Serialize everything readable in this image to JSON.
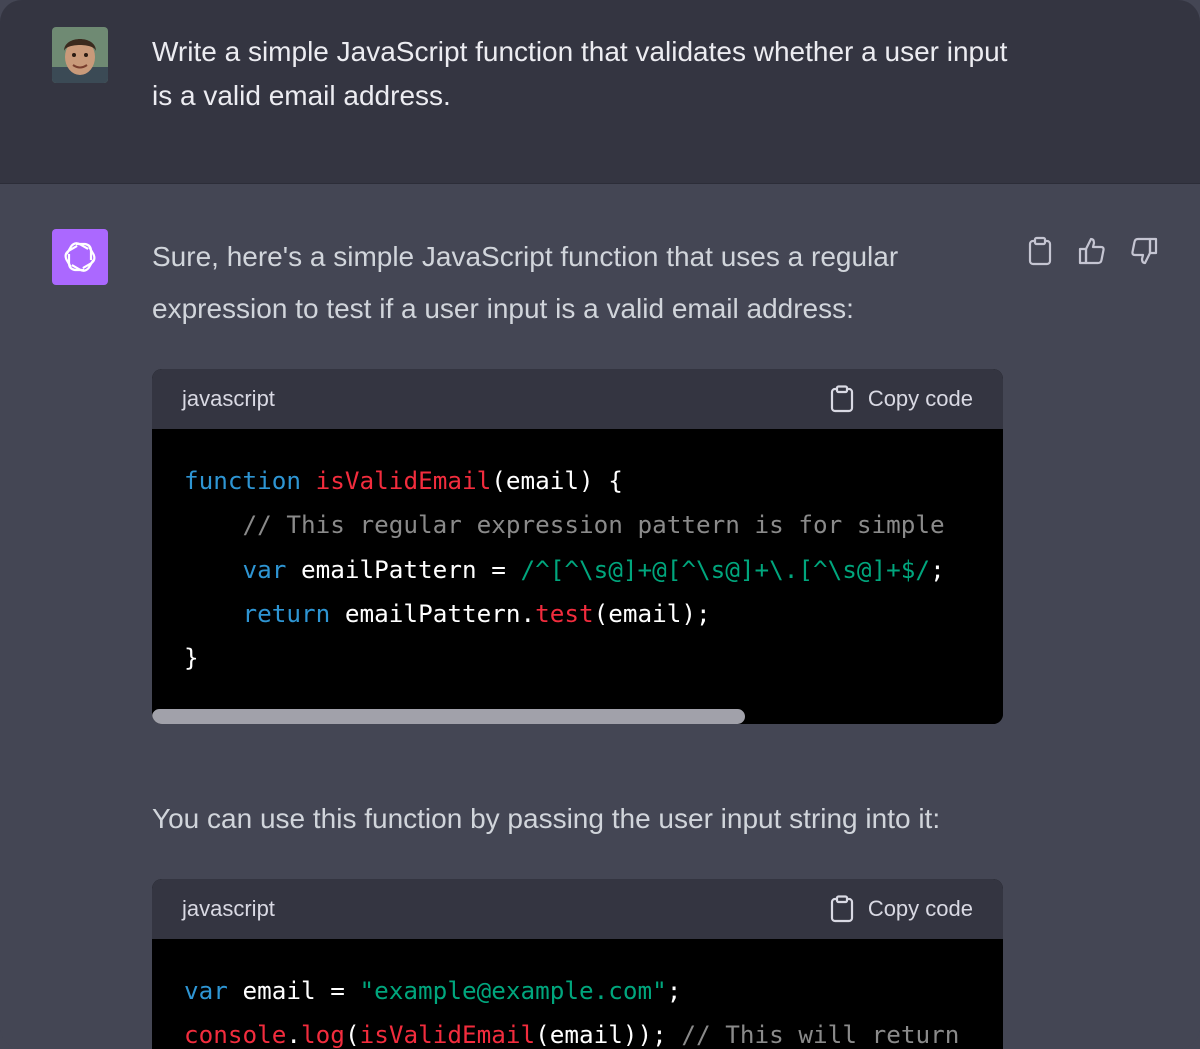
{
  "user_message": {
    "text": "Write a simple JavaScript function that validates whether a user input is a valid email address."
  },
  "assistant_message": {
    "intro": "Sure, here's a simple JavaScript function that uses a regular expression to test if a user input is a valid email address:",
    "after_text": "You can use this function by passing the user input string into it:",
    "actions": [
      "clipboard-icon",
      "thumbs-up-icon",
      "thumbs-down-icon"
    ]
  },
  "code_blocks": [
    {
      "language": "javascript",
      "copy_label": "Copy code",
      "lines": [
        [
          {
            "t": "kw",
            "v": "function"
          },
          {
            "t": "p",
            "v": " "
          },
          {
            "t": "fn",
            "v": "isValidEmail"
          },
          {
            "t": "p",
            "v": "(email) {"
          }
        ],
        [
          {
            "t": "p",
            "v": "    "
          },
          {
            "t": "cm",
            "v": "// This regular expression pattern is for simple"
          }
        ],
        [
          {
            "t": "p",
            "v": "    "
          },
          {
            "t": "kw",
            "v": "var"
          },
          {
            "t": "p",
            "v": " emailPattern = "
          },
          {
            "t": "rx",
            "v": "/^[^\\s@]+@[^\\s@]+\\.[^\\s@]+$/"
          },
          {
            "t": "p",
            "v": ";"
          }
        ],
        [
          {
            "t": "p",
            "v": "    "
          },
          {
            "t": "kw",
            "v": "return"
          },
          {
            "t": "p",
            "v": " emailPattern."
          },
          {
            "t": "fn",
            "v": "test"
          },
          {
            "t": "p",
            "v": "(email);"
          }
        ],
        [
          {
            "t": "p",
            "v": "}"
          }
        ]
      ],
      "scroll_fraction": 0.7
    },
    {
      "language": "javascript",
      "copy_label": "Copy code",
      "lines": [
        [
          {
            "t": "kw",
            "v": "var"
          },
          {
            "t": "p",
            "v": " email = "
          },
          {
            "t": "str",
            "v": "\"example@example.com\""
          },
          {
            "t": "p",
            "v": ";"
          }
        ],
        [
          {
            "t": "fn",
            "v": "console"
          },
          {
            "t": "p",
            "v": "."
          },
          {
            "t": "fn",
            "v": "log"
          },
          {
            "t": "p",
            "v": "("
          },
          {
            "t": "fn",
            "v": "isValidEmail"
          },
          {
            "t": "p",
            "v": "(email)); "
          },
          {
            "t": "cm",
            "v": "// This will return"
          }
        ]
      ]
    }
  ],
  "colors": {
    "user_bg": "#343541",
    "assistant_bg": "#444654",
    "code_header_bg": "#343541",
    "code_bg": "#000000",
    "bot_avatar": "#ab68ff",
    "keyword": "#2e95d3",
    "function": "#f22c3d",
    "comment": "#8a8a8a",
    "string": "#00a67d"
  }
}
